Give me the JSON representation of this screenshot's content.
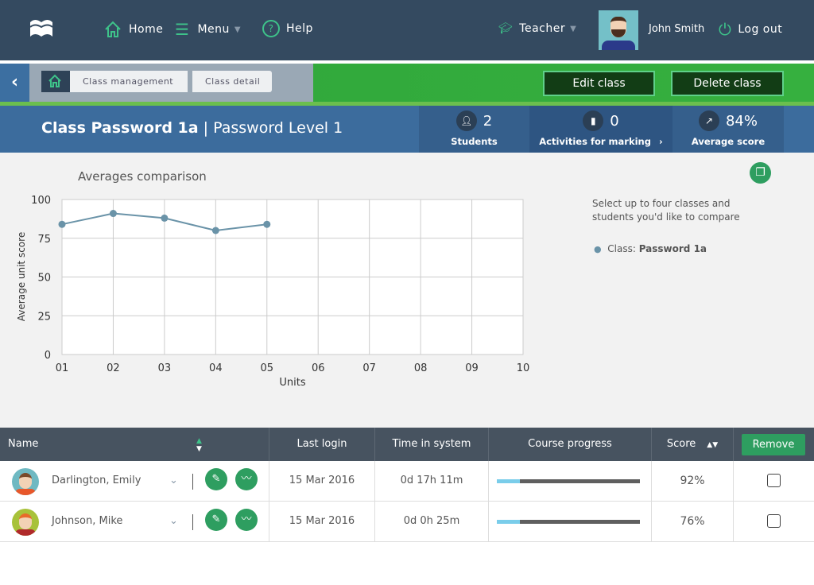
{
  "header": {
    "nav": [
      {
        "label": "Home",
        "icon": "home-icon"
      },
      {
        "label": "Menu",
        "icon": "hamburger-icon"
      },
      {
        "label": "Help",
        "icon": "help-icon"
      }
    ],
    "role": "Teacher",
    "user": "John Smith",
    "logout": "Log out"
  },
  "breadcrumb": [
    "Class management",
    "Class detail"
  ],
  "actions": {
    "edit": "Edit class",
    "delete": "Delete class"
  },
  "class": {
    "name": "Class Password 1a",
    "sep": "|",
    "level": "Password Level 1"
  },
  "stats": [
    {
      "value": "2",
      "label": "Students",
      "icon": "user-icon"
    },
    {
      "value": "0",
      "label": "Activities for marking",
      "icon": "notebook-icon"
    },
    {
      "value": "84%",
      "label": "Average score",
      "icon": "trend-icon"
    }
  ],
  "chart_data": {
    "type": "line",
    "title": "Averages comparison",
    "xlabel": "Units",
    "ylabel": "Average unit score",
    "categories": [
      "01",
      "02",
      "03",
      "04",
      "05",
      "06",
      "07",
      "08",
      "09",
      "10"
    ],
    "yticks": [
      "0",
      "25",
      "50",
      "75",
      "100"
    ],
    "ylim": [
      0,
      100
    ],
    "grid": true,
    "series": [
      {
        "name": "Password 1a",
        "values": [
          84,
          91,
          88,
          80,
          84
        ],
        "color": "#6a93a8"
      }
    ]
  },
  "compare": {
    "hint": "Select up to four classes and students you'd like to compare",
    "legend_prefix": "Class:",
    "legend_name": "Password 1a"
  },
  "table": {
    "headers": {
      "name": "Name",
      "last_login": "Last login",
      "time": "Time in system",
      "progress": "Course progress",
      "score": "Score",
      "remove": "Remove"
    },
    "rows": [
      {
        "name": "Darlington, Emily",
        "last_login": "15 Mar 2016",
        "time": "0d 17h 11m",
        "progress": 16,
        "score": "92%"
      },
      {
        "name": "Johnson, Mike",
        "last_login": "15 Mar 2016",
        "time": "0d 0h 25m",
        "progress": 16,
        "score": "76%"
      }
    ]
  }
}
